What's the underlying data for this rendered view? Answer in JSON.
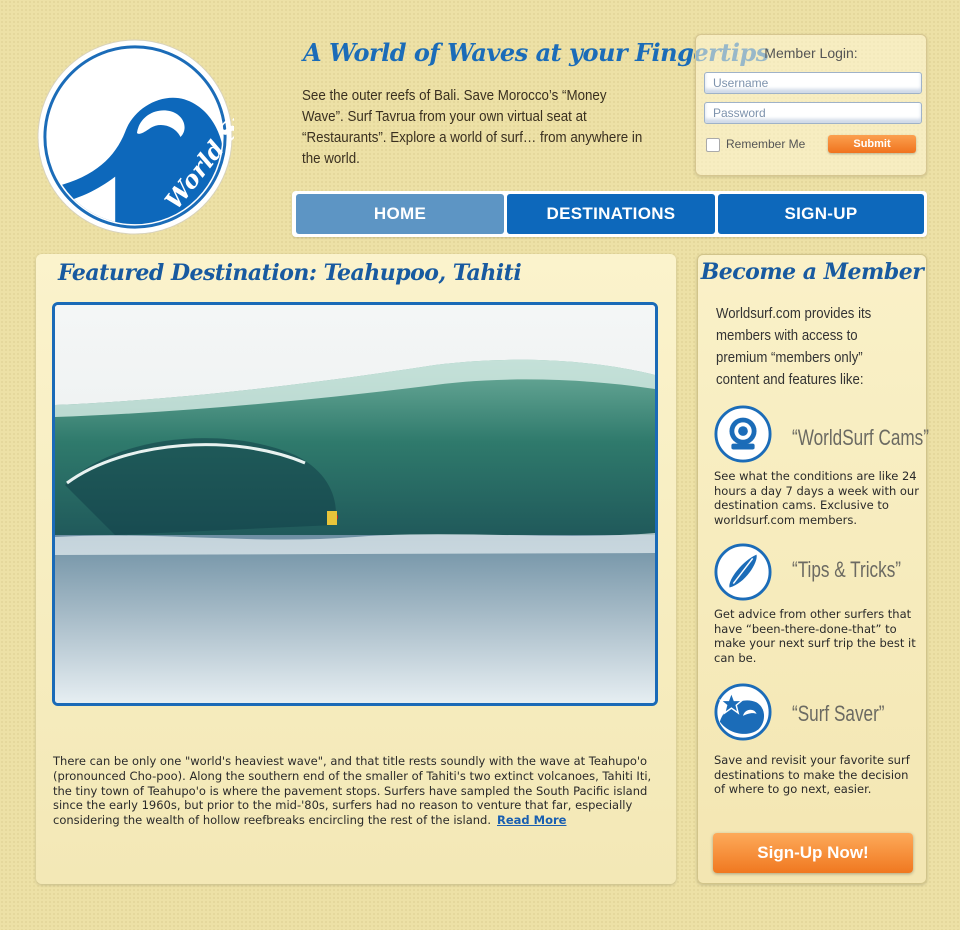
{
  "colors": {
    "brand_blue": "#0d68bb",
    "heading_blue": "#1b6cb8",
    "accent_orange": "#f07820",
    "sand_background": "#ede1a6"
  },
  "logo": {
    "text": "World Surf",
    "icon": "wave-logo-icon"
  },
  "header": {
    "headline": "A World of Waves at your Fingertips",
    "intro": "See the outer reefs of Bali. Save Morocco’s “Money Wave”. Surf Tavrua from your own virtual seat at “Restaurants”. Explore a world of surf… from anywhere in the world."
  },
  "login": {
    "title": "Member Login:",
    "username_placeholder": "Username",
    "password_placeholder": "Password",
    "remember_label": "Remember Me",
    "remember_checked": false,
    "submit_label": "Submit"
  },
  "nav": {
    "items": [
      {
        "label": "HOME",
        "active": true
      },
      {
        "label": "DESTINATIONS",
        "active": false
      },
      {
        "label": "SIGN-UP",
        "active": false
      }
    ]
  },
  "featured": {
    "title": "Featured Destination: Teahupoo, Tahiti",
    "body": "There can be only one \"world's heaviest wave\", and that title rests soundly with the wave at Teahupo'o (pronounced Cho-poo). Along the southern end of the smaller of Tahiti's two extinct volcanoes, Tahiti Iti, the tiny town of Teahupo'o is where the pavement stops. Surfers have sampled the South Pacific island since the early 1960s, but prior to the mid-'80s, surfers had no reason to venture that far, especially considering the wealth of hollow reefbreaks encircling the rest of the island.",
    "read_more": "Read More"
  },
  "member": {
    "title": "Become a Member",
    "intro": "Worldsurf.com provides its members with access to premium “members only” content and features like:",
    "features": [
      {
        "icon": "webcam-icon",
        "name": "“WorldSurf Cams”",
        "desc": "See what the conditions are like 24 hours a day 7 days a week with our destination cams. Exclusive to worldsurf.com members."
      },
      {
        "icon": "surfboard-icon",
        "name": "“Tips & Tricks”",
        "desc": "Get advice from other surfers that have “been-there-done-that” to make your next surf trip the best it can be."
      },
      {
        "icon": "star-wave-icon",
        "name": "“Surf Saver”",
        "desc": "Save and revisit your favorite surf destinations to make the decision of where to go next, easier."
      }
    ],
    "signup_label": "Sign-Up Now!"
  }
}
